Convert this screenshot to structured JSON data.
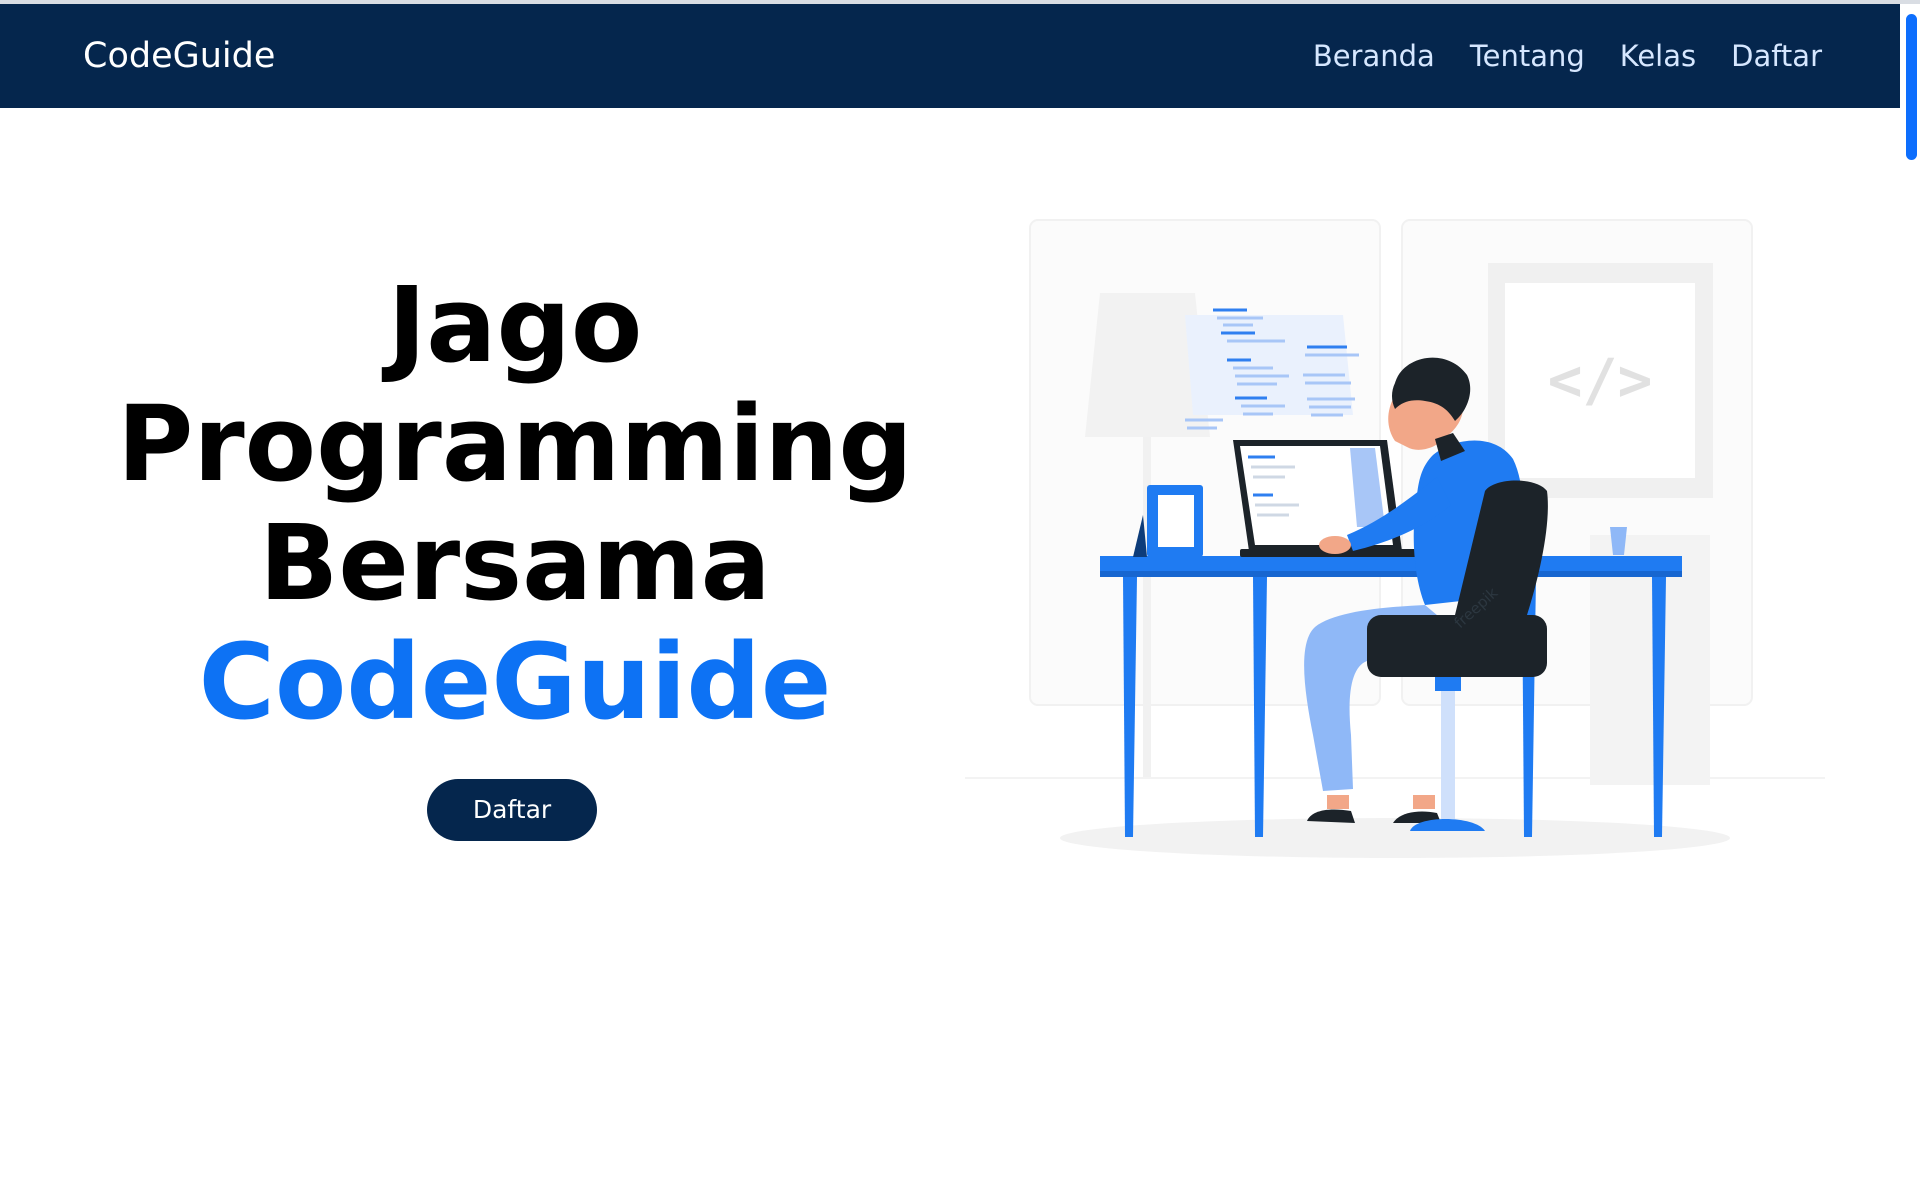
{
  "navbar": {
    "brand": "CodeGuide",
    "links": [
      "Beranda",
      "Tentang",
      "Kelas",
      "Daftar"
    ]
  },
  "hero": {
    "title_lines": [
      "Jago",
      "Programming",
      "Bersama"
    ],
    "title_accent": "CodeGuide",
    "cta_label": "Daftar"
  },
  "illustration": {
    "icon": "developer-at-desk-illustration",
    "code_sign": "</>",
    "watermark": "freepik"
  },
  "colors": {
    "navbar": "#05264d",
    "accent": "#0d72f4",
    "button": "#05264d",
    "scroll_thumb": "#0d6efd"
  }
}
